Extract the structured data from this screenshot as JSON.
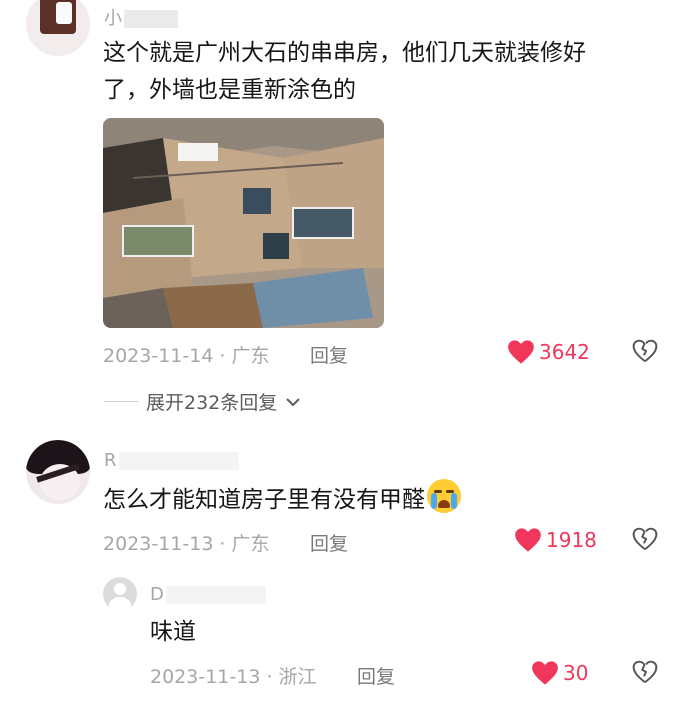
{
  "comments": [
    {
      "username": "小",
      "text_line1": "这个就是广州大石的串串房，他们几天就装修好",
      "text_line2": "了，外墙也是重新涂色的",
      "date": "2023-11-14",
      "location": "广东",
      "reply_label": "回复",
      "likes": "3642",
      "expand_label": "展开232条回复"
    },
    {
      "username": "R",
      "text": "怎么才能知道房子里有没有甲醛",
      "emoji": "loudly-crying-face",
      "date": "2023-11-13",
      "location": "广东",
      "reply_label": "回复",
      "likes": "1918"
    }
  ],
  "sub_reply": {
    "username": "D",
    "text": "味道",
    "date": "2023-11-13",
    "location": "浙江",
    "reply_label": "回复",
    "likes": "30"
  },
  "colors": {
    "like": "#f0365a",
    "meta": "#a6a6a6",
    "text": "#161616"
  },
  "icons": [
    "heart-icon",
    "broken-heart-icon",
    "chevron-down-icon",
    "default-avatar-icon"
  ]
}
